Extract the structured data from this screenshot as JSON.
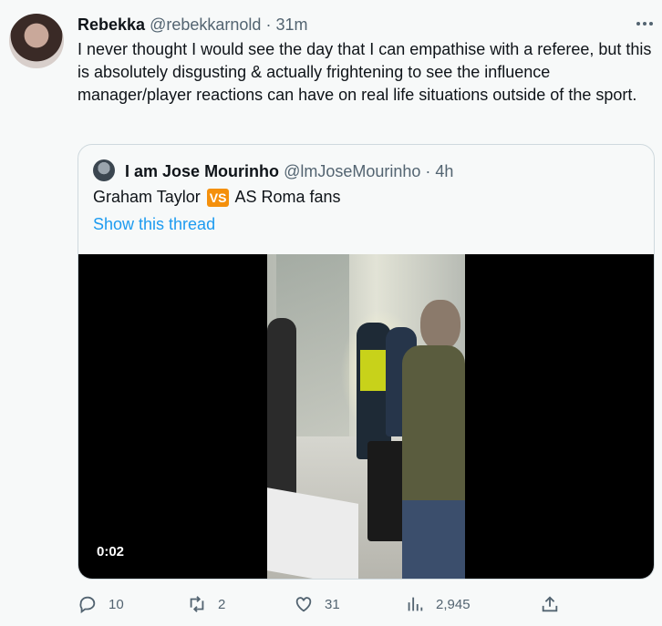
{
  "author": {
    "name": "Rebekka",
    "handle": "@rebekkarnold",
    "separator": "·",
    "time": "31m"
  },
  "tweet_text": "I never thought I would see the day that I can empathise with a referee, but this is absolutely disgusting & actually frightening to see the influence manager/player reactions can have on real life situations outside of the sport.",
  "quoted": {
    "name": "I am Jose Mourinho",
    "handle": "@lmJoseMourinho",
    "separator": "·",
    "time": "4h",
    "text_before": "Graham Taylor",
    "vs_badge": "VS",
    "text_after": "AS Roma fans",
    "show_thread": "Show this thread",
    "video_time": "0:02"
  },
  "actions": {
    "replies": "10",
    "retweets": "2",
    "likes": "31",
    "views": "2,945"
  },
  "icons": {
    "reply": "reply-icon",
    "retweet": "retweet-icon",
    "like": "heart-icon",
    "views": "views-icon",
    "share": "share-icon",
    "more": "more-icon"
  },
  "colors": {
    "link": "#1d9bf0",
    "muted": "#536471",
    "vs_badge": "#f4900c"
  }
}
